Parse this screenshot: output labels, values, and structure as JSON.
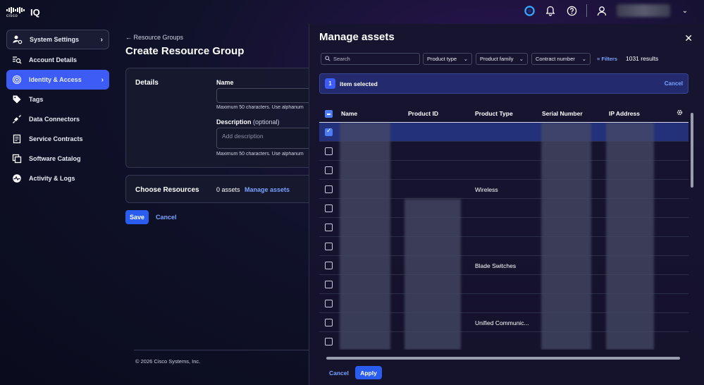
{
  "app": {
    "brand": "cisco",
    "product": "IQ"
  },
  "header": {
    "user_name": ""
  },
  "sidebar": {
    "items": [
      {
        "label": "System Settings",
        "icon": "users-gear-icon",
        "state": "expanded-header"
      },
      {
        "label": "Account Details",
        "icon": "account-search-icon"
      },
      {
        "label": "Identity & Access",
        "icon": "fingerprint-icon",
        "state": "active"
      },
      {
        "label": "Tags",
        "icon": "tag-icon"
      },
      {
        "label": "Data Connectors",
        "icon": "plug-icon"
      },
      {
        "label": "Service Contracts",
        "icon": "contract-icon"
      },
      {
        "label": "Software Catalog",
        "icon": "catalog-icon"
      },
      {
        "label": "Activity & Logs",
        "icon": "activity-icon"
      }
    ]
  },
  "page": {
    "back_link": "Resource Groups",
    "title": "Create Resource Group",
    "details_label": "Details",
    "name_label": "Name",
    "name_hint": "Maximum 50 characters. Use alphanum",
    "description_label": "Description",
    "description_optional": "(optional)",
    "description_placeholder": "Add description",
    "description_hint": "Maximum 50 characters. Use alphanum",
    "resources_label": "Choose Resources",
    "assets_count": "0 assets",
    "manage_assets": "Manage assets",
    "save": "Save",
    "cancel": "Cancel",
    "copyright": "© 2026 Cisco Systems, Inc."
  },
  "modal": {
    "title": "Manage assets",
    "search_placeholder": "Search",
    "filters": [
      "Product type",
      "Product family",
      "Contract number"
    ],
    "filters_link": "Filters",
    "results": "1031 results",
    "selected_count": "1",
    "selected_label": "item selected",
    "selected_cancel": "Cancel",
    "columns": [
      "Name",
      "Product ID",
      "Product Type",
      "Serial Number",
      "IP Address"
    ],
    "rows": [
      {
        "checked": true,
        "product_type": ""
      },
      {
        "checked": false,
        "product_type": ""
      },
      {
        "checked": false,
        "product_type": ""
      },
      {
        "checked": false,
        "product_type": "Wireless"
      },
      {
        "checked": false,
        "product_type": ""
      },
      {
        "checked": false,
        "product_type": ""
      },
      {
        "checked": false,
        "product_type": ""
      },
      {
        "checked": false,
        "product_type": "Blade Switches"
      },
      {
        "checked": false,
        "product_type": ""
      },
      {
        "checked": false,
        "product_type": ""
      },
      {
        "checked": false,
        "product_type": "Unified Communic..."
      },
      {
        "checked": false,
        "product_type": ""
      }
    ],
    "cancel": "Cancel",
    "apply": "Apply"
  },
  "colors": {
    "accent": "#2b5cf0",
    "link": "#7aa2ff",
    "selected_row": "#23307a"
  }
}
